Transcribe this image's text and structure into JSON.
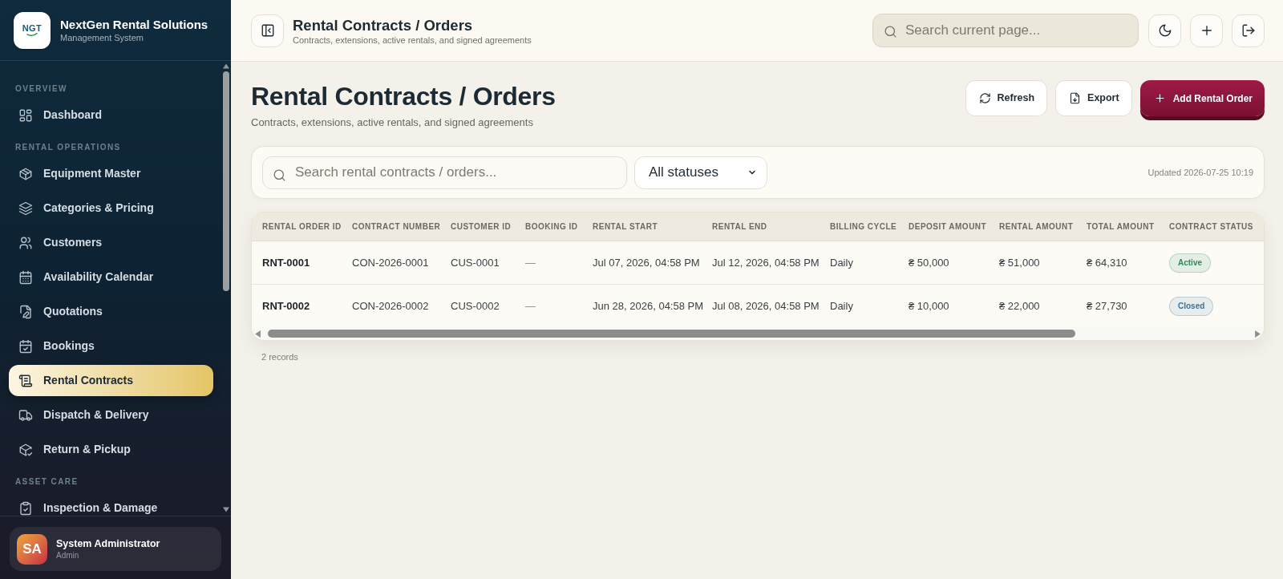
{
  "sidebar": {
    "brand": {
      "logo_text": "NGT",
      "title": "NextGen Rental Solutions",
      "subtitle": "Management System"
    },
    "sections": [
      {
        "label": "OVERVIEW",
        "items": [
          {
            "label": "Dashboard",
            "selected": false
          }
        ]
      },
      {
        "label": "RENTAL OPERATIONS",
        "items": [
          {
            "label": "Equipment Master",
            "selected": false
          },
          {
            "label": "Categories & Pricing",
            "selected": false
          },
          {
            "label": "Customers",
            "selected": false
          },
          {
            "label": "Availability Calendar",
            "selected": false
          },
          {
            "label": "Quotations",
            "selected": false
          },
          {
            "label": "Bookings",
            "selected": false
          },
          {
            "label": "Rental Contracts",
            "selected": true
          },
          {
            "label": "Dispatch & Delivery",
            "selected": false
          },
          {
            "label": "Return & Pickup",
            "selected": false
          }
        ]
      },
      {
        "label": "ASSET CARE",
        "items": [
          {
            "label": "Inspection & Damage",
            "selected": false
          }
        ]
      }
    ],
    "user": {
      "initials": "SA",
      "name": "System Administrator",
      "role": "Admin"
    }
  },
  "header": {
    "title": "Rental Contracts / Orders",
    "subtitle": "Contracts, extensions, active rentals, and signed agreements",
    "search": {
      "placeholder": "Search current page..."
    }
  },
  "page": {
    "title": "Rental Contracts / Orders",
    "subtitle": "Contracts, extensions, active rentals, and signed agreements",
    "buttons": [
      {
        "label": "Refresh",
        "kind": "secondary"
      },
      {
        "label": "Export",
        "kind": "secondary"
      },
      {
        "label": "Add Rental Order",
        "kind": "primary"
      }
    ]
  },
  "filters": {
    "search": {
      "placeholder": "Search rental contracts / orders..."
    },
    "status": {
      "value": "All statuses"
    },
    "updated": "Updated 2026-07-25 10:19"
  },
  "table": {
    "columns": [
      "RENTAL ORDER ID",
      "CONTRACT NUMBER",
      "CUSTOMER ID",
      "BOOKING ID",
      "RENTAL START",
      "RENTAL END",
      "BILLING CYCLE",
      "DEPOSIT AMOUNT",
      "RENTAL AMOUNT",
      "TOTAL AMOUNT",
      "CONTRACT STATUS"
    ],
    "rows": [
      {
        "cells": [
          "RNT-0001",
          "CON-2026-0001",
          "CUS-0001",
          "—",
          "Jul 07, 2026, 04:58 PM",
          "Jul 12, 2026, 04:58 PM",
          "Daily",
          "₴ 50,000",
          "₴ 51,000",
          "₴ 64,310"
        ],
        "status": {
          "label": "Active",
          "color": "#2f8a57"
        }
      },
      {
        "cells": [
          "RNT-0002",
          "CON-2026-0002",
          "CUS-0002",
          "—",
          "Jun 28, 2026, 04:58 PM",
          "Jul 08, 2026, 04:58 PM",
          "Daily",
          "₴ 10,000",
          "₴ 22,000",
          "₴ 27,730"
        ],
        "status": {
          "label": "Closed",
          "color": "#3c7399"
        }
      }
    ]
  },
  "footer": {
    "records": "2 records"
  }
}
